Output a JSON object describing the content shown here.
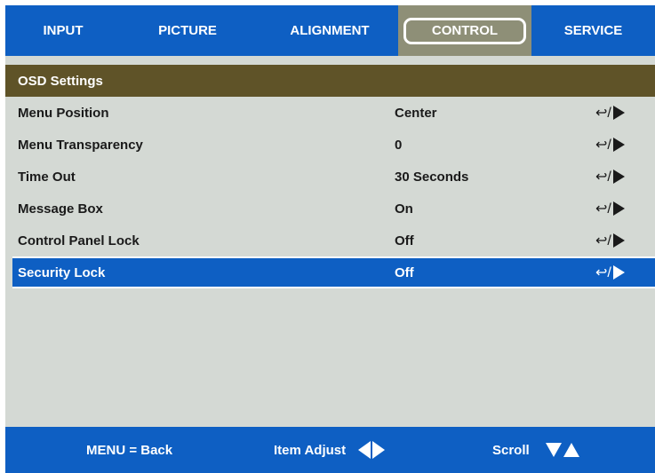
{
  "tabs": [
    {
      "label": "INPUT"
    },
    {
      "label": "PICTURE"
    },
    {
      "label": "ALIGNMENT"
    },
    {
      "label": "CONTROL",
      "active": true
    },
    {
      "label": "SERVICE"
    }
  ],
  "section": {
    "title": "OSD Settings"
  },
  "rows": [
    {
      "label": "Menu Position",
      "value": "Center",
      "adjust": "↩/"
    },
    {
      "label": "Menu Transparency",
      "value": "0",
      "adjust": "↩/"
    },
    {
      "label": "Time Out",
      "value": "30 Seconds",
      "adjust": "↩/"
    },
    {
      "label": "Message Box",
      "value": "On",
      "adjust": "↩/"
    },
    {
      "label": "Control Panel Lock",
      "value": "Off",
      "adjust": "↩/"
    },
    {
      "label": "Security Lock",
      "value": "Off",
      "adjust": "↩/",
      "selected": true
    }
  ],
  "footer": {
    "back": "MENU = Back",
    "adjust": "Item Adjust",
    "scroll": "Scroll"
  },
  "colors": {
    "blue": "#0e5fc3",
    "olive_header": "#5f5328",
    "active_tab": "#8e8f77",
    "panel": "#d4d9d4"
  }
}
